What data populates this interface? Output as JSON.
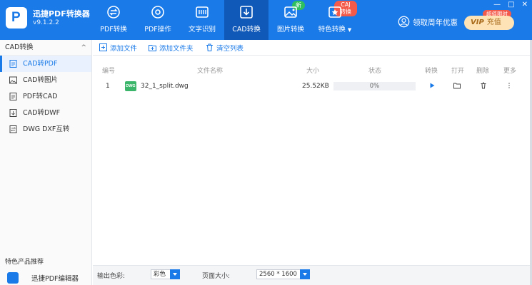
{
  "app": {
    "name": "迅捷PDF转换器",
    "version": "v9.1.2.2",
    "logo_letter": "P"
  },
  "nav_tabs": [
    {
      "label": "PDF转换",
      "icon": "swap-icon"
    },
    {
      "label": "PDF操作",
      "icon": "gear-icon"
    },
    {
      "label": "文字识别",
      "icon": "scan-icon"
    },
    {
      "label": "CAD转换",
      "icon": "cad-icon",
      "active": true
    },
    {
      "label": "图片转换",
      "icon": "image-icon",
      "badge": "新"
    },
    {
      "label": "特色转换",
      "icon": "star-icon",
      "badge": "CAJ转换",
      "dropdown": "▼"
    }
  ],
  "header": {
    "promo_label": "领取周年优惠",
    "hot_label": "超值限时",
    "vip_label": "VIP",
    "recharge_label": "充值",
    "window_controls": [
      "—",
      "□",
      "✕"
    ]
  },
  "sidebar": {
    "section_title": "CAD转换",
    "collapse_glyph": "^",
    "items": [
      {
        "label": "CAD转PDF",
        "active": true
      },
      {
        "label": "CAD转图片"
      },
      {
        "label": "PDF转CAD"
      },
      {
        "label": "CAD转DWF"
      },
      {
        "label": "DWG DXF互转"
      }
    ],
    "footer_title": "特色产品推荐",
    "footer_item": "迅捷PDF编辑器"
  },
  "toolbar": {
    "add_file": "添加文件",
    "add_folder": "添加文件夹",
    "clear_list": "清空列表"
  },
  "table": {
    "headers": [
      "编号",
      "文件名称",
      "大小",
      "状态",
      "转换",
      "打开",
      "删除",
      "更多"
    ],
    "rows": [
      {
        "index": "1",
        "file_badge": "DWG",
        "name": "32_1_split.dwg",
        "size": "25.52KB",
        "progress": 0,
        "progress_label": "0%"
      }
    ]
  },
  "options": {
    "color_label": "输出色彩:",
    "color_value": "彩色",
    "page_size_label": "页面大小:",
    "page_size_value": "2560 * 1600"
  },
  "colors": {
    "primary": "#1a7ae8",
    "primary_dark": "#1159b8",
    "new_badge": "#2fbf5f",
    "hot_badge": "#f45a4a"
  }
}
